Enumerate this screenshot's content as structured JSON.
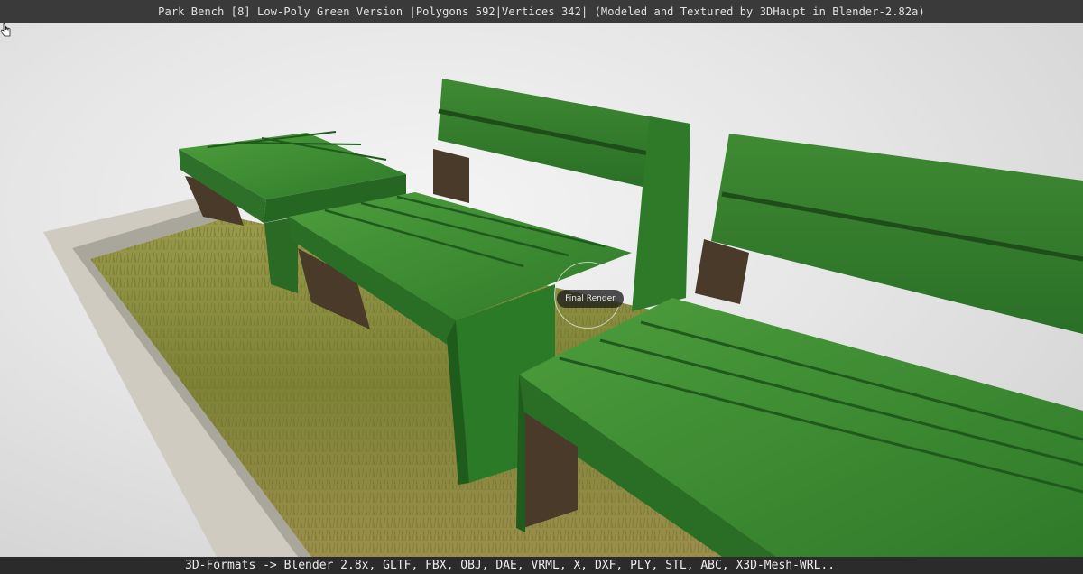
{
  "header": {
    "title": "Park Bench [8] Low-Poly Green Version |Polygons 592|Vertices 342| (Modeled and Textured by 3DHaupt in Blender-2.82a)"
  },
  "viewport": {
    "render_button_label": "Final Render",
    "colors": {
      "bench_green": "#2f7a2a",
      "bench_green_light": "#4c9a3a",
      "bench_green_dark": "#1f5a1c",
      "bench_leg": "#4a3a2a",
      "grass": "#8a8a3c",
      "planter": "#c9c6bc",
      "background": "#e6e6e6"
    }
  },
  "footer": {
    "formats_text": "3D-Formats -> Blender 2.8x, GLTF, FBX, OBJ, DAE, VRML, X, DXF, PLY, STL, ABC, X3D-Mesh-WRL.."
  }
}
